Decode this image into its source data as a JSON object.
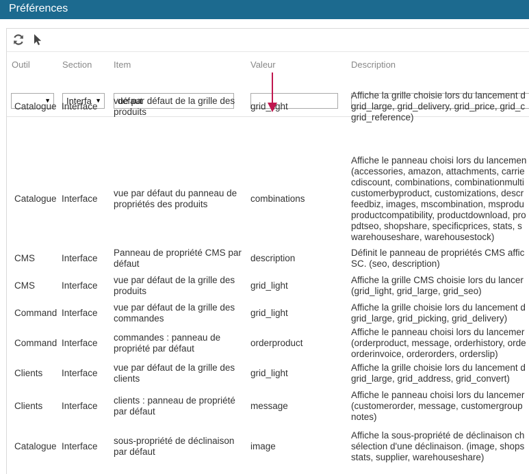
{
  "window": {
    "title": "Préférences"
  },
  "toolbar": {
    "refresh_icon": "refresh-icon",
    "pointer_icon": "pointer-icon"
  },
  "columns": {
    "outil": "Outil",
    "section": "Section",
    "item": "Item",
    "valeur": "Valeur",
    "description": "Description"
  },
  "filters": {
    "outil": "",
    "section": "Interfa",
    "item": "défaut",
    "valeur": "",
    "description": ""
  },
  "annotation": {
    "color": "#c0174f"
  },
  "rows": [
    {
      "outil": "Catalogue",
      "section": "Interface",
      "item": "vue par défaut de la grille des produits",
      "valeur": "grid_light",
      "desc": [
        "Affiche la grille choisie lors du lancement d",
        "grid_large, grid_delivery, grid_price, grid_c",
        "grid_reference)"
      ]
    },
    {
      "outil": "Catalogue",
      "section": "Interface",
      "item": "vue par défaut du panneau de propriétés des produits",
      "valeur": "combinations",
      "desc": [
        "Affiche le panneau choisi lors du lancemen",
        "(accessories, amazon, attachments, carrie",
        "cdiscount, combinations, combinationmulti",
        "customerbyproduct, customizations, descr",
        "feedbiz, images, mscombination, msprodu",
        "productcompatibility, productdownload, pro",
        "pdtseo, shopshare, specificprices, stats, s",
        "warehouseshare, warehousestock)"
      ]
    },
    {
      "outil": "CMS",
      "section": "Interface",
      "item": "Panneau de propriété CMS par défaut",
      "valeur": "description",
      "desc": [
        "Définit le panneau de propriétés CMS affic",
        "SC. (seo, description)"
      ]
    },
    {
      "outil": "CMS",
      "section": "Interface",
      "item": "vue par défaut de la grille des produits",
      "valeur": "grid_light",
      "desc": [
        "Affiche la grille CMS choisie lors du lancer",
        "(grid_light, grid_large, grid_seo)"
      ]
    },
    {
      "outil": "Command",
      "section": "Interface",
      "item": "vue par défaut de la grille des commandes",
      "valeur": "grid_light",
      "desc": [
        "Affiche la grille choisie lors du lancement d",
        "grid_large, grid_picking, grid_delivery)"
      ]
    },
    {
      "outil": "Command",
      "section": "Interface",
      "item": "commandes : panneau de propriété par défaut",
      "valeur": "orderproduct",
      "desc": [
        "Affiche le panneau choisi lors du lancemer",
        "(orderproduct, message, orderhistory, orde",
        "orderinvoice, orderorders, orderslip)"
      ]
    },
    {
      "outil": "Clients",
      "section": "Interface",
      "item": "vue par défaut de la grille des clients",
      "valeur": "grid_light",
      "desc": [
        "Affiche la grille choisie lors du lancement d",
        "grid_large, grid_address, grid_convert)"
      ]
    },
    {
      "outil": "Clients",
      "section": "Interface",
      "item": "clients : panneau de propriété par défaut",
      "valeur": "message",
      "desc": [
        "Affiche le panneau choisi lors du lancemer",
        "(customerorder, message, customergroup",
        "notes)"
      ]
    },
    {
      "outil": "Catalogue",
      "section": "Interface",
      "item": "sous-propriété de déclinaison par défaut",
      "valeur": "image",
      "desc": [
        "Affiche la sous-propriété de déclinaison ch",
        "sélection d'une déclinaison. (image, shops",
        "stats, supplier, warehouseshare)"
      ]
    }
  ]
}
